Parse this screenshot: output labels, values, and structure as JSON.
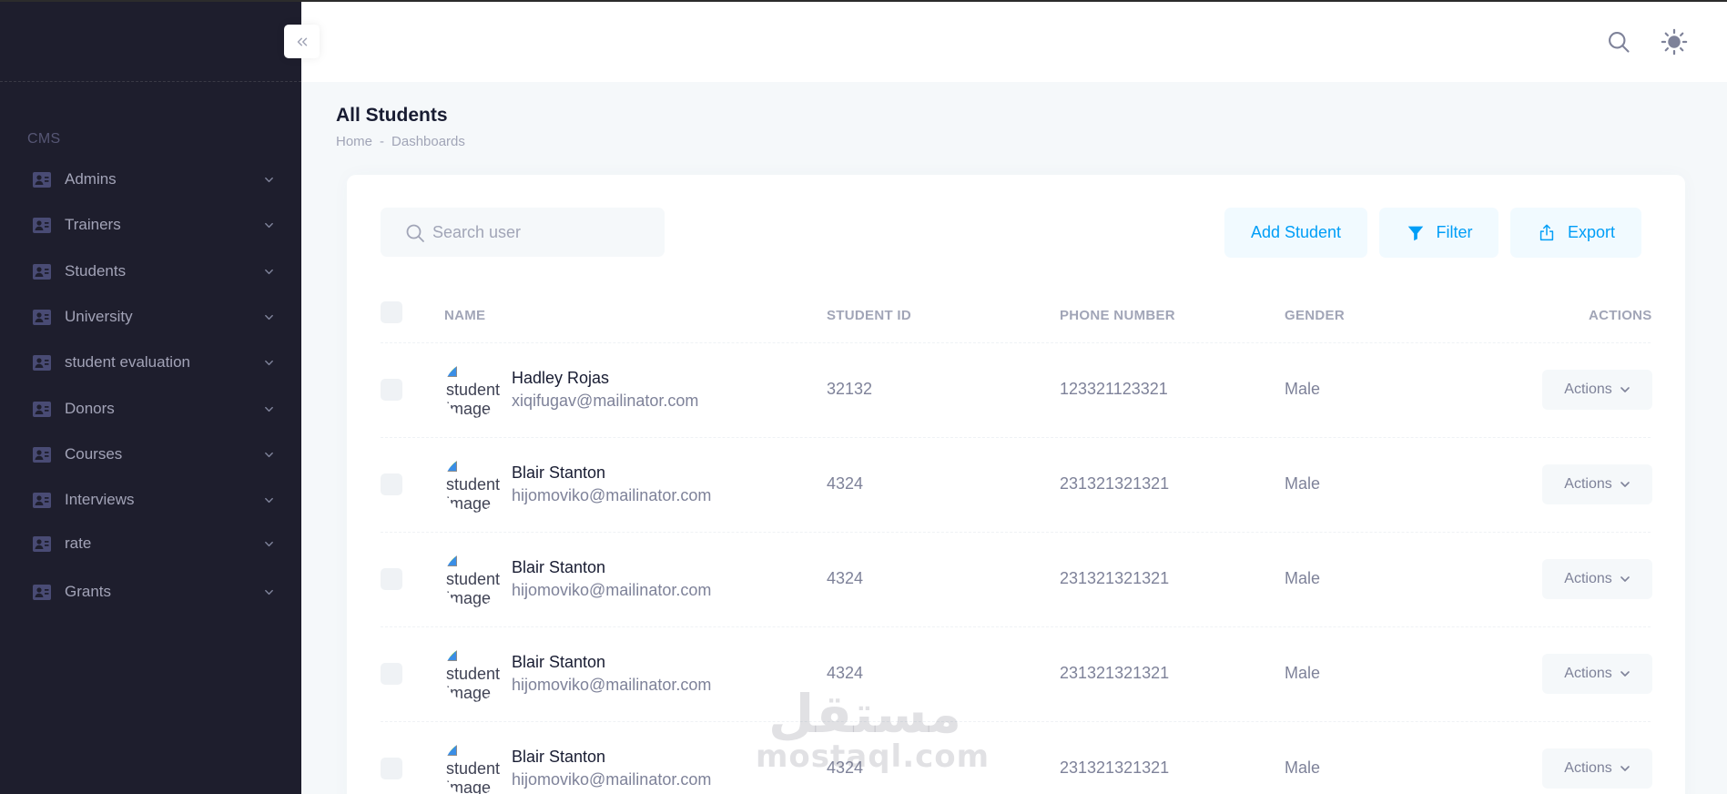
{
  "sidebar": {
    "section_label": "CMS",
    "items": [
      {
        "label": "Admins"
      },
      {
        "label": "Trainers"
      },
      {
        "label": "Students"
      },
      {
        "label": "University"
      },
      {
        "label": "student evaluation"
      },
      {
        "label": "Donors"
      },
      {
        "label": "Courses"
      },
      {
        "label": "Interviews"
      },
      {
        "label": "rate"
      },
      {
        "label": "Grants"
      }
    ]
  },
  "page": {
    "title": "All Students",
    "breadcrumb": [
      "Home",
      "-",
      "Dashboards"
    ]
  },
  "toolbar": {
    "search_placeholder": "Search user",
    "add_label": "Add Student",
    "filter_label": "Filter",
    "export_label": "Export"
  },
  "table": {
    "columns": [
      "NAME",
      "STUDENT ID",
      "PHONE NUMBER",
      "GENDER",
      "ACTIONS"
    ],
    "avatar_alt": "student image",
    "action_label": "Actions",
    "rows": [
      {
        "name": "Hadley Rojas",
        "email": "xiqifugav@mailinator.com",
        "student_id": "32132",
        "phone": "123321123321",
        "gender": "Male"
      },
      {
        "name": "Blair Stanton",
        "email": "hijomoviko@mailinator.com",
        "student_id": "4324",
        "phone": "231321321321",
        "gender": "Male"
      },
      {
        "name": "Blair Stanton",
        "email": "hijomoviko@mailinator.com",
        "student_id": "4324",
        "phone": "231321321321",
        "gender": "Male"
      },
      {
        "name": "Blair Stanton",
        "email": "hijomoviko@mailinator.com",
        "student_id": "4324",
        "phone": "231321321321",
        "gender": "Male"
      },
      {
        "name": "Blair Stanton",
        "email": "hijomoviko@mailinator.com",
        "student_id": "4324",
        "phone": "231321321321",
        "gender": "Male"
      }
    ]
  },
  "watermark": {
    "arabic": "مستقل",
    "latin": "mostaql.com"
  },
  "colors": {
    "sidebar_bg": "#1e1e2d",
    "primary": "#009ef7",
    "primary_light": "#f1faff",
    "muted_text": "#a1a5b7"
  }
}
